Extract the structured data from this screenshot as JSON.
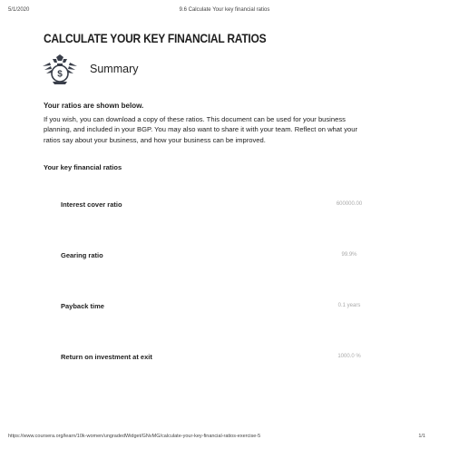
{
  "print_header": {
    "date": "5/1/2020",
    "title": "9.6 Calculate Your key financial ratios"
  },
  "page": {
    "title": "CALCULATE YOUR KEY FINANCIAL RATIOS",
    "summary_label": "Summary",
    "emblem_icon": "money-bag-emblem-icon",
    "emblem_glyph": "$"
  },
  "intro": {
    "heading": "Your ratios are shown below.",
    "lines": [
      "If you wish, you can download a copy of these ratios. This document can be used for your business",
      "planning, and included in your BGP. You may also want to share it with your team. Reflect on what your",
      "ratios say about your business, and how your business can be improved."
    ]
  },
  "ratios_section": {
    "heading": "Your key financial ratios",
    "items": [
      {
        "label": "Interest cover ratio",
        "value": "600000.00"
      },
      {
        "label": "Gearing ratio",
        "value": "99.9%"
      },
      {
        "label": "Payback time",
        "value": "0.1 years"
      },
      {
        "label": "Return on investment at exit",
        "value": "1000.0 %"
      }
    ]
  },
  "print_footer": {
    "url": "https://www.coursera.org/learn/10k-women/ungradedWidget/GNvMG/calculate-your-key-financial-ratios-exercise-5",
    "page": "1/1"
  },
  "colors": {
    "text": "#1f1f1f",
    "value_gray": "#aaaaaa",
    "emblem": "#3a3f4a"
  }
}
